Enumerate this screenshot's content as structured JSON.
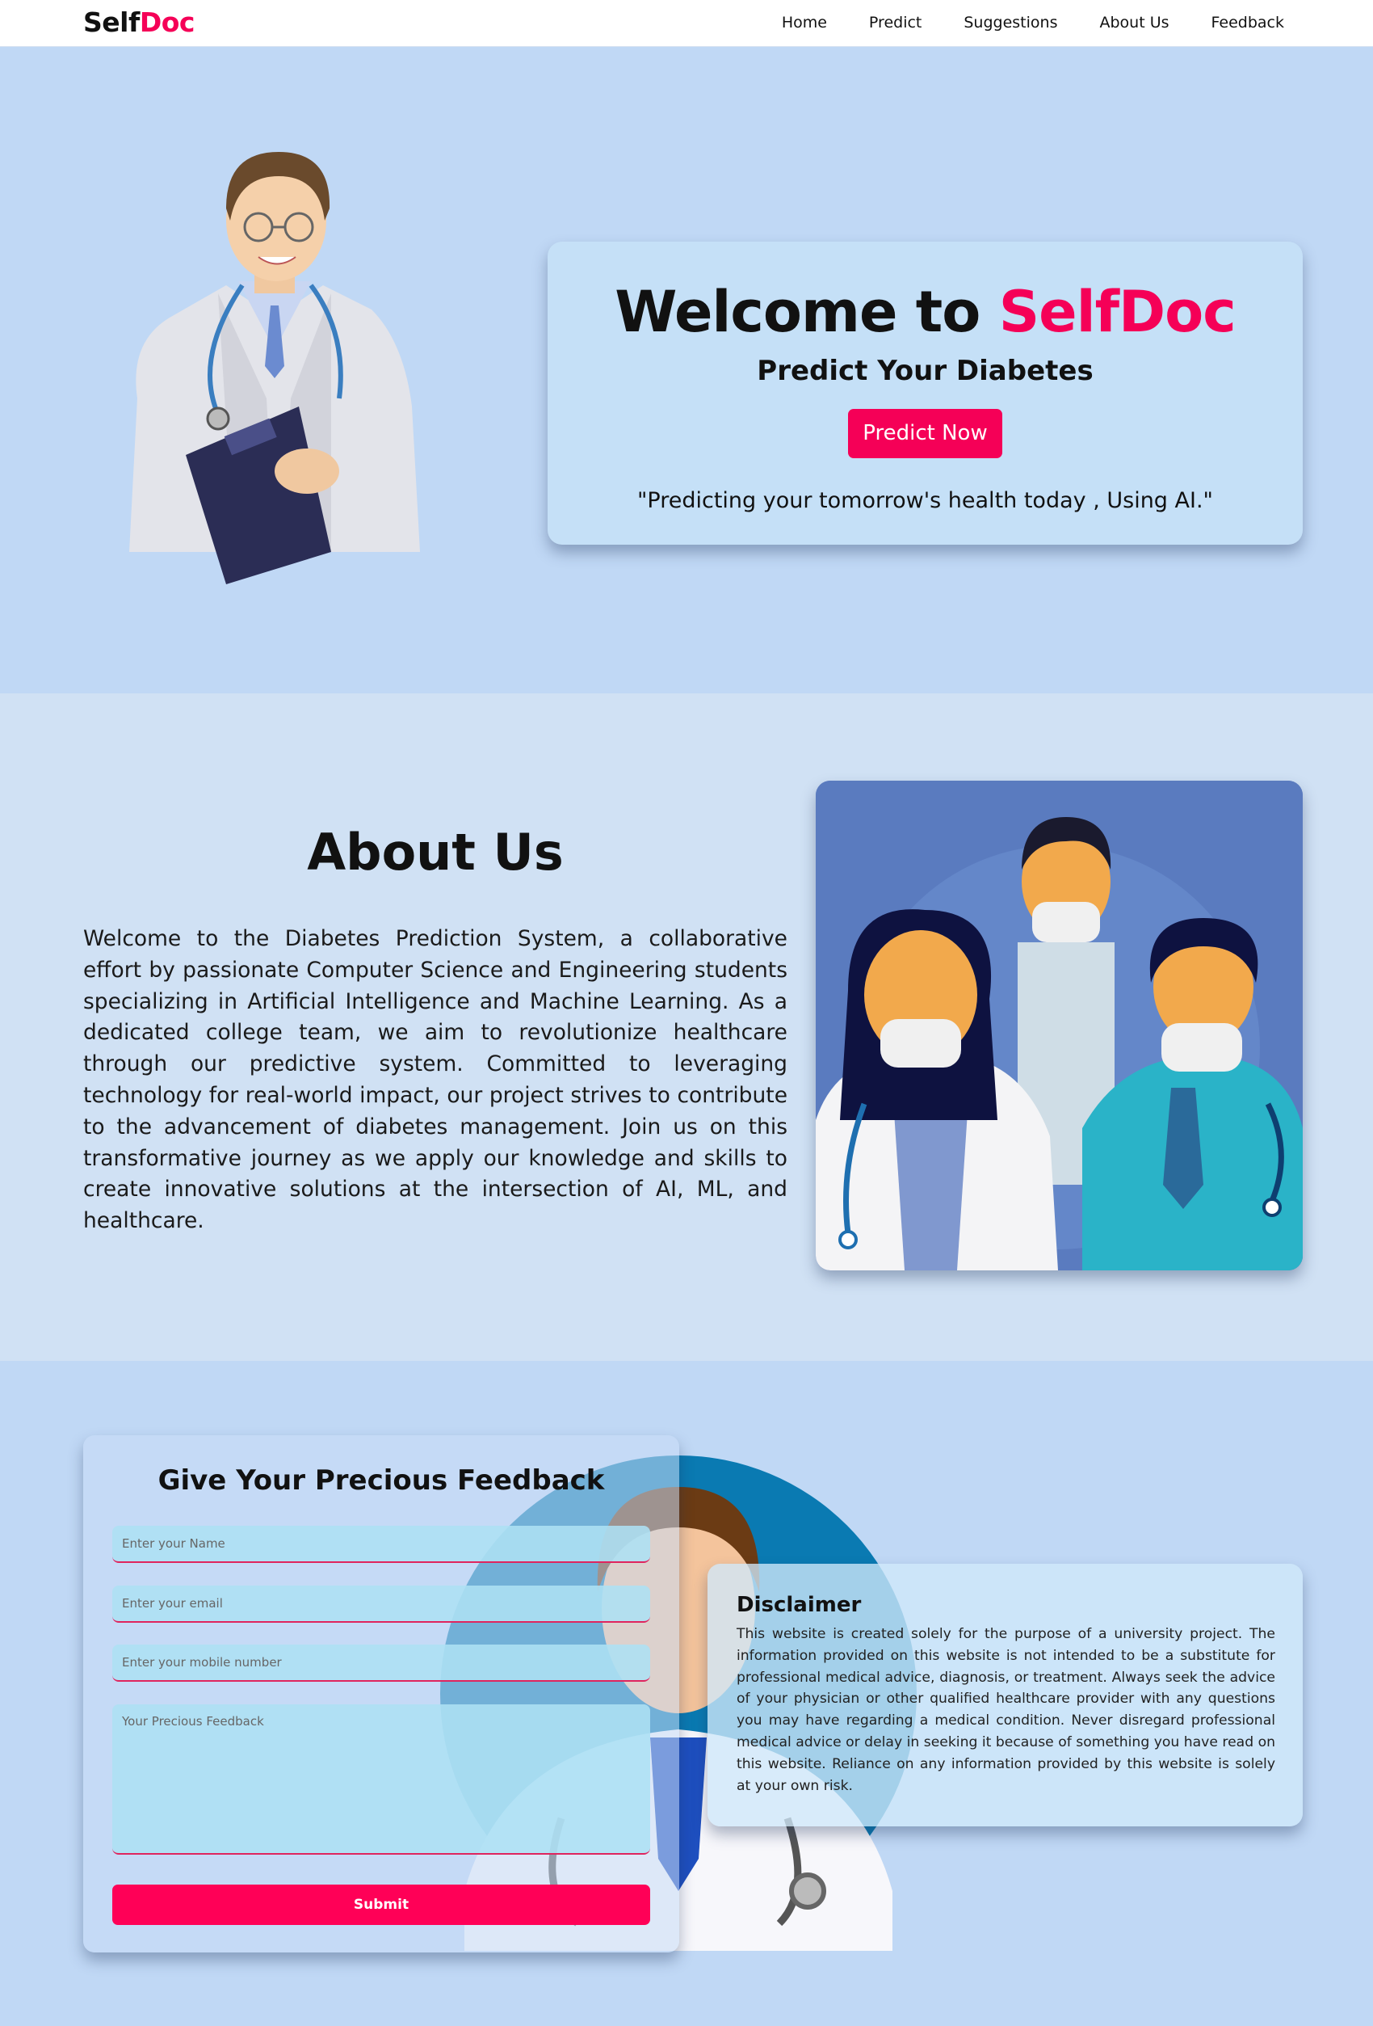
{
  "brand": {
    "part1": "Self",
    "part2": "Doc"
  },
  "nav": {
    "items": [
      "Home",
      "Predict",
      "Suggestions",
      "About Us",
      "Feedback"
    ]
  },
  "hero": {
    "title_prefix": "Welcome to ",
    "title_brand": "SelfDoc",
    "subtitle": "Predict Your Diabetes",
    "button_label": "Predict Now",
    "tagline": "\"Predicting your tomorrow's health today , Using AI.\""
  },
  "about": {
    "title": "About Us",
    "text": "Welcome to the Diabetes Prediction System, a collaborative effort by passionate Computer Science and Engineering students specializing in Artificial Intelligence and Machine Learning. As a dedicated college team, we aim to revolutionize healthcare through our predictive system. Committed to leveraging technology for real-world impact, our project strives to contribute to the advancement of diabetes management. Join us on this transformative journey as we apply our knowledge and skills to create innovative solutions at the intersection of AI, ML, and healthcare."
  },
  "feedback": {
    "title": "Give Your Precious Feedback",
    "name_placeholder": "Enter your Name",
    "email_placeholder": "Enter your email",
    "mobile_placeholder": "Enter your mobile number",
    "message_placeholder": "Your Precious Feedback",
    "submit_label": "Submit"
  },
  "disclaimer": {
    "title": "Disclaimer",
    "text": "This website is created solely for the purpose of a university project. The information provided on this website is not intended to be a substitute for professional medical advice, diagnosis, or treatment. Always seek the advice of your physician or other qualified healthcare provider with any questions you may have regarding a medical condition. Never disregard professional medical advice or delay in seeking it because of something you have read on this website. Reliance on any information provided by this website is solely at your own risk."
  },
  "colors": {
    "accent": "#f50057",
    "page_bg": "#c0d8f5",
    "about_bg": "#d0e1f4"
  },
  "icons": [
    "doctor-illustration",
    "medical-team-illustration",
    "doctor-background-illustration"
  ]
}
